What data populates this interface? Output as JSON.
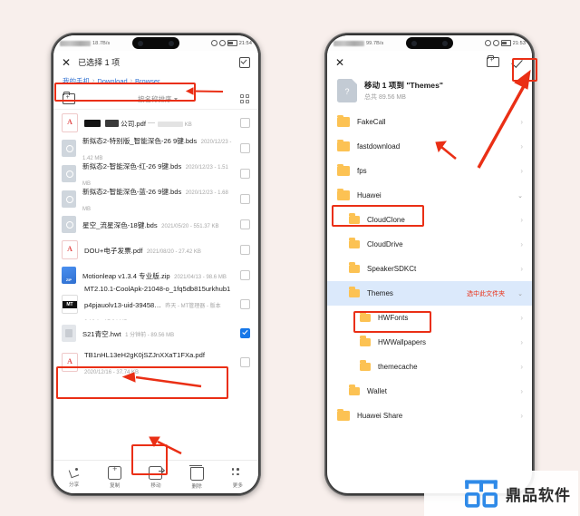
{
  "watermark": {
    "text": "鼎品软件"
  },
  "left_phone": {
    "status": {
      "net_speed": "18.7B/s",
      "time": "21:54"
    },
    "header": {
      "close_label": "✕",
      "title": "已选择 1 项",
      "select_all_name": "select-all-checkbox"
    },
    "breadcrumb": {
      "root": "我的手机",
      "sep": "›",
      "mid": "Download",
      "current": "Browser"
    },
    "sortbar": {
      "sort_label": "按名称排序",
      "new_folder": "new-folder-icon",
      "grid": "grid-view-icon"
    },
    "files": [
      {
        "name_redacted": true,
        "name": "公司.pdf",
        "sub": "KB",
        "type": "pdf",
        "checked": false,
        "sub_redacted": true
      },
      {
        "name": "新拟态2-特别版_智能深色-26 9键.bds",
        "sub": "2020/12/23 - 1.42 MB",
        "type": "bds",
        "checked": false
      },
      {
        "name": "新拟态2-智能深色-红-26 9键.bds",
        "sub": "2020/12/23 - 1.51 MB",
        "type": "bds",
        "checked": false
      },
      {
        "name": "新拟态2-智能深色-蓝-26 9键.bds",
        "sub": "2020/12/23 - 1.68 MB",
        "type": "bds",
        "checked": false
      },
      {
        "name": "星空_流星深色-18键.bds",
        "sub": "2021/05/20 - 551.37 KB",
        "type": "bds",
        "checked": false
      },
      {
        "name": "DOU+电子发票.pdf",
        "sub": "2021/08/20 - 27.42 KB",
        "type": "pdf",
        "checked": false
      },
      {
        "name": "Motionleap v1.3.4 专业版.zip",
        "sub": "2021/04/13 - 98.6 MB",
        "type": "zip",
        "checked": false
      },
      {
        "name": "MT2.10.1-CoolApk-21048-o_1fq5db815urkhub1p4pjauolv13-uid-39458…",
        "sub": "昨天 - MT管理器 - 版本 2.10.1 - 17.24 MB",
        "type": "apk",
        "checked": false
      },
      {
        "name": "S21青空.hwt",
        "sub": "1 分钟前 - 89.56 MB",
        "type": "hwt",
        "checked": true
      },
      {
        "name": "TB1nHL13eH2gK0jSZJnXXaT1FXa.pdf",
        "sub": "2020/12/16 - 37.74 KB",
        "type": "pdf",
        "checked": false
      }
    ],
    "actions": [
      {
        "label": "分享",
        "icon": "share-icon"
      },
      {
        "label": "复制",
        "icon": "copy-icon"
      },
      {
        "label": "移动",
        "icon": "move-icon"
      },
      {
        "label": "删除",
        "icon": "delete-icon"
      },
      {
        "label": "更多",
        "icon": "more-icon"
      }
    ]
  },
  "right_phone": {
    "status": {
      "net_speed": "99.7B/s",
      "time": "21:53"
    },
    "header": {
      "close_label": "✕",
      "new_folder": "new-folder-icon",
      "confirm": "confirm-check-icon"
    },
    "move_info": {
      "title": "移动 1 项到 \"Themes\"",
      "subtitle": "总共 89.56 MB"
    },
    "folders": [
      {
        "name": "FakeCall",
        "indent": 0,
        "chev": "›",
        "highlight": false
      },
      {
        "name": "fastdownload",
        "indent": 0,
        "chev": "›",
        "highlight": false
      },
      {
        "name": "fps",
        "indent": 0,
        "chev": "›",
        "highlight": false
      },
      {
        "name": "Huawei",
        "indent": 0,
        "chev": "⌄",
        "highlight": false,
        "boxed": true
      },
      {
        "name": "CloudClone",
        "indent": 1,
        "chev": "›",
        "highlight": false
      },
      {
        "name": "CloudDrive",
        "indent": 1,
        "chev": "›",
        "highlight": false
      },
      {
        "name": "SpeakerSDKCt",
        "indent": 1,
        "chev": "›",
        "highlight": false
      },
      {
        "name": "Themes",
        "indent": 1,
        "chev": "⌄",
        "highlight": true,
        "boxed": true,
        "annotation": "选中此文件夹"
      },
      {
        "name": "HWFonts",
        "indent": 2,
        "chev": "›",
        "highlight": false
      },
      {
        "name": "HWWallpapers",
        "indent": 2,
        "chev": "›",
        "highlight": false
      },
      {
        "name": "themecache",
        "indent": 2,
        "chev": "›",
        "highlight": false
      },
      {
        "name": "Wallet",
        "indent": 1,
        "chev": "›",
        "highlight": false
      },
      {
        "name": "Huawei Share",
        "indent": 0,
        "chev": "›",
        "highlight": false
      }
    ]
  },
  "colors": {
    "accent_red": "#ea2f15",
    "link_blue": "#2f6fd0",
    "select_blue": "#1677e8",
    "highlight_blue": "#dbe9fb",
    "folder_yellow": "#fcc253"
  }
}
